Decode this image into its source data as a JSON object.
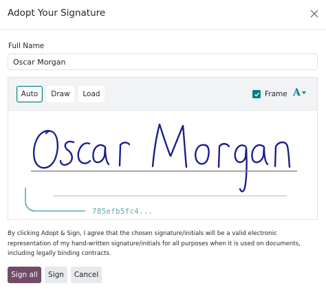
{
  "dialog": {
    "title": "Adopt Your Signature",
    "close_icon": "close-icon"
  },
  "form": {
    "label": "Full Name",
    "name_value": "Oscar Morgan"
  },
  "toolbar": {
    "modes": [
      {
        "label": "Auto",
        "active": true
      },
      {
        "label": "Draw",
        "active": false
      },
      {
        "label": "Load",
        "active": false
      }
    ],
    "frame_label": "Frame",
    "frame_checked": true,
    "font_icon": "font-style-icon"
  },
  "signature": {
    "text": "Oscar Morgan",
    "color": "#1a1f8c",
    "hash": "785efb5fc4..."
  },
  "legal_text": "By clicking Adopt & Sign, I agree that the chosen signature/initials will be a valid electronic representation of my hand-written signature/initials for all purposes when it is used on documents, including legally binding contracts.",
  "footer": {
    "sign_all": "Sign all",
    "sign": "Sign",
    "cancel": "Cancel"
  },
  "colors": {
    "accent": "#017e84",
    "primary": "#714b67"
  }
}
